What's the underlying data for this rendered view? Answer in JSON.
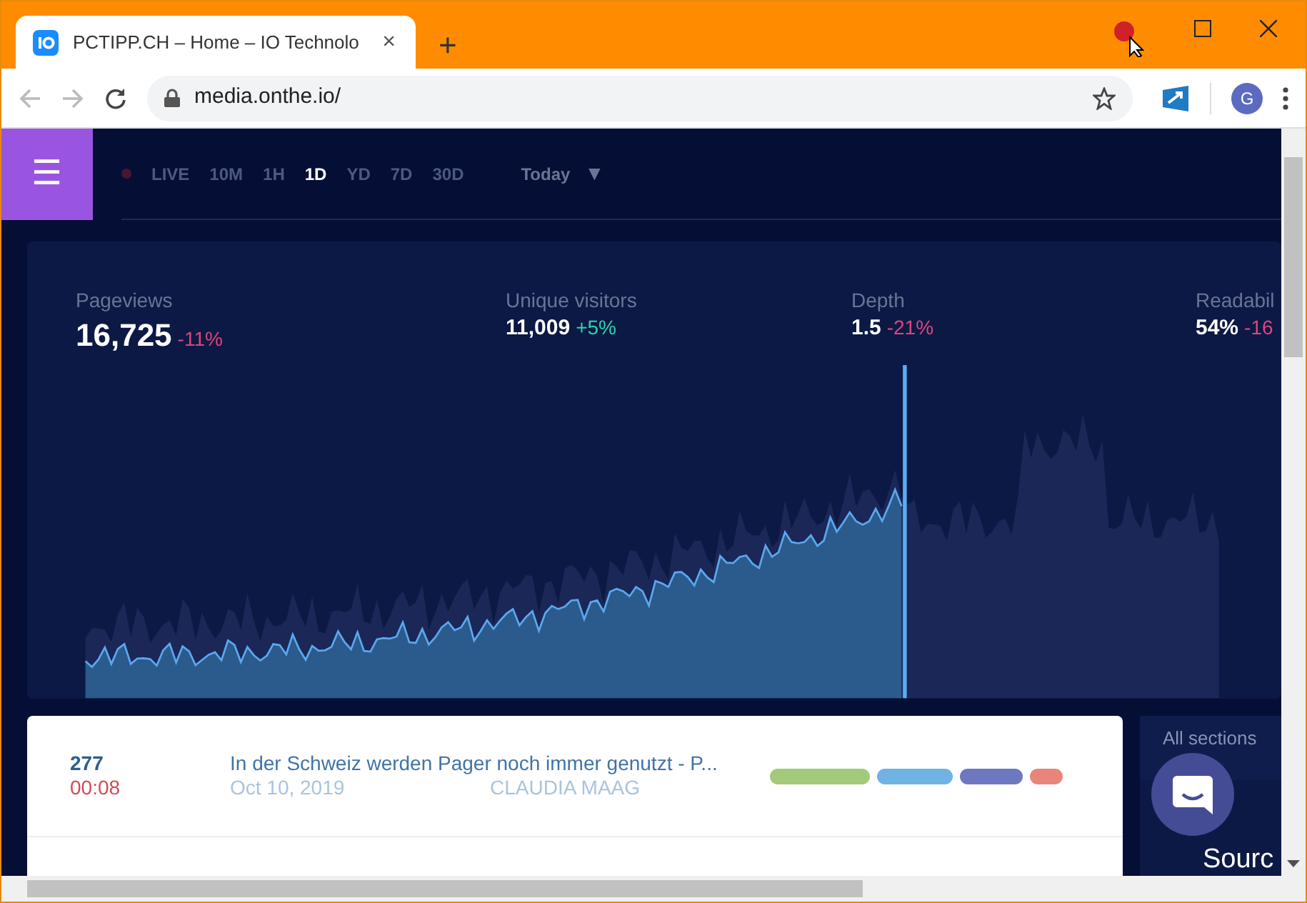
{
  "browser": {
    "tab": {
      "title": "PCTIPP.CH – Home – IO Technolo",
      "close": "×"
    },
    "new_tab": "+",
    "url": "media.onthe.io/",
    "avatar": "G"
  },
  "menu_button": "☰",
  "time_filters": [
    {
      "label": "LIVE",
      "selected": false
    },
    {
      "label": "10M",
      "selected": false
    },
    {
      "label": "1H",
      "selected": false
    },
    {
      "label": "1D",
      "selected": true
    },
    {
      "label": "YD",
      "selected": false
    },
    {
      "label": "7D",
      "selected": false
    },
    {
      "label": "30D",
      "selected": false
    }
  ],
  "date_range": {
    "label": "Today",
    "caret": "▼"
  },
  "metrics": [
    {
      "kind": "main",
      "label": "Pageviews",
      "value": "16,725",
      "change": "-11%",
      "color": "#e0457b"
    },
    {
      "kind": "minor",
      "label": "Unique visitors",
      "value": "11,009",
      "change": "+5%",
      "color": "#2ed3b0"
    },
    {
      "kind": "minor",
      "label": "Depth",
      "value": "1.5",
      "change": "-21%",
      "color": "#e0457b"
    },
    {
      "kind": "minor",
      "label": "Readabil",
      "value": "54%",
      "change": "-16",
      "color": "#e0457b"
    }
  ],
  "articles": [
    {
      "views": "277",
      "time": "00:08",
      "title": "In der Schweiz werden Pager noch immer genutzt - P...",
      "date": "Oct 10, 2019",
      "author": "CLAUDIA MAAG",
      "bars": [
        {
          "color": "#a3c97a"
        },
        {
          "color": "#6fb3e3"
        },
        {
          "color": "#6e78c0"
        },
        {
          "color": "#e8857a"
        }
      ]
    }
  ],
  "side_panel": {
    "sections": "All sections",
    "sources": "Sourc"
  }
}
